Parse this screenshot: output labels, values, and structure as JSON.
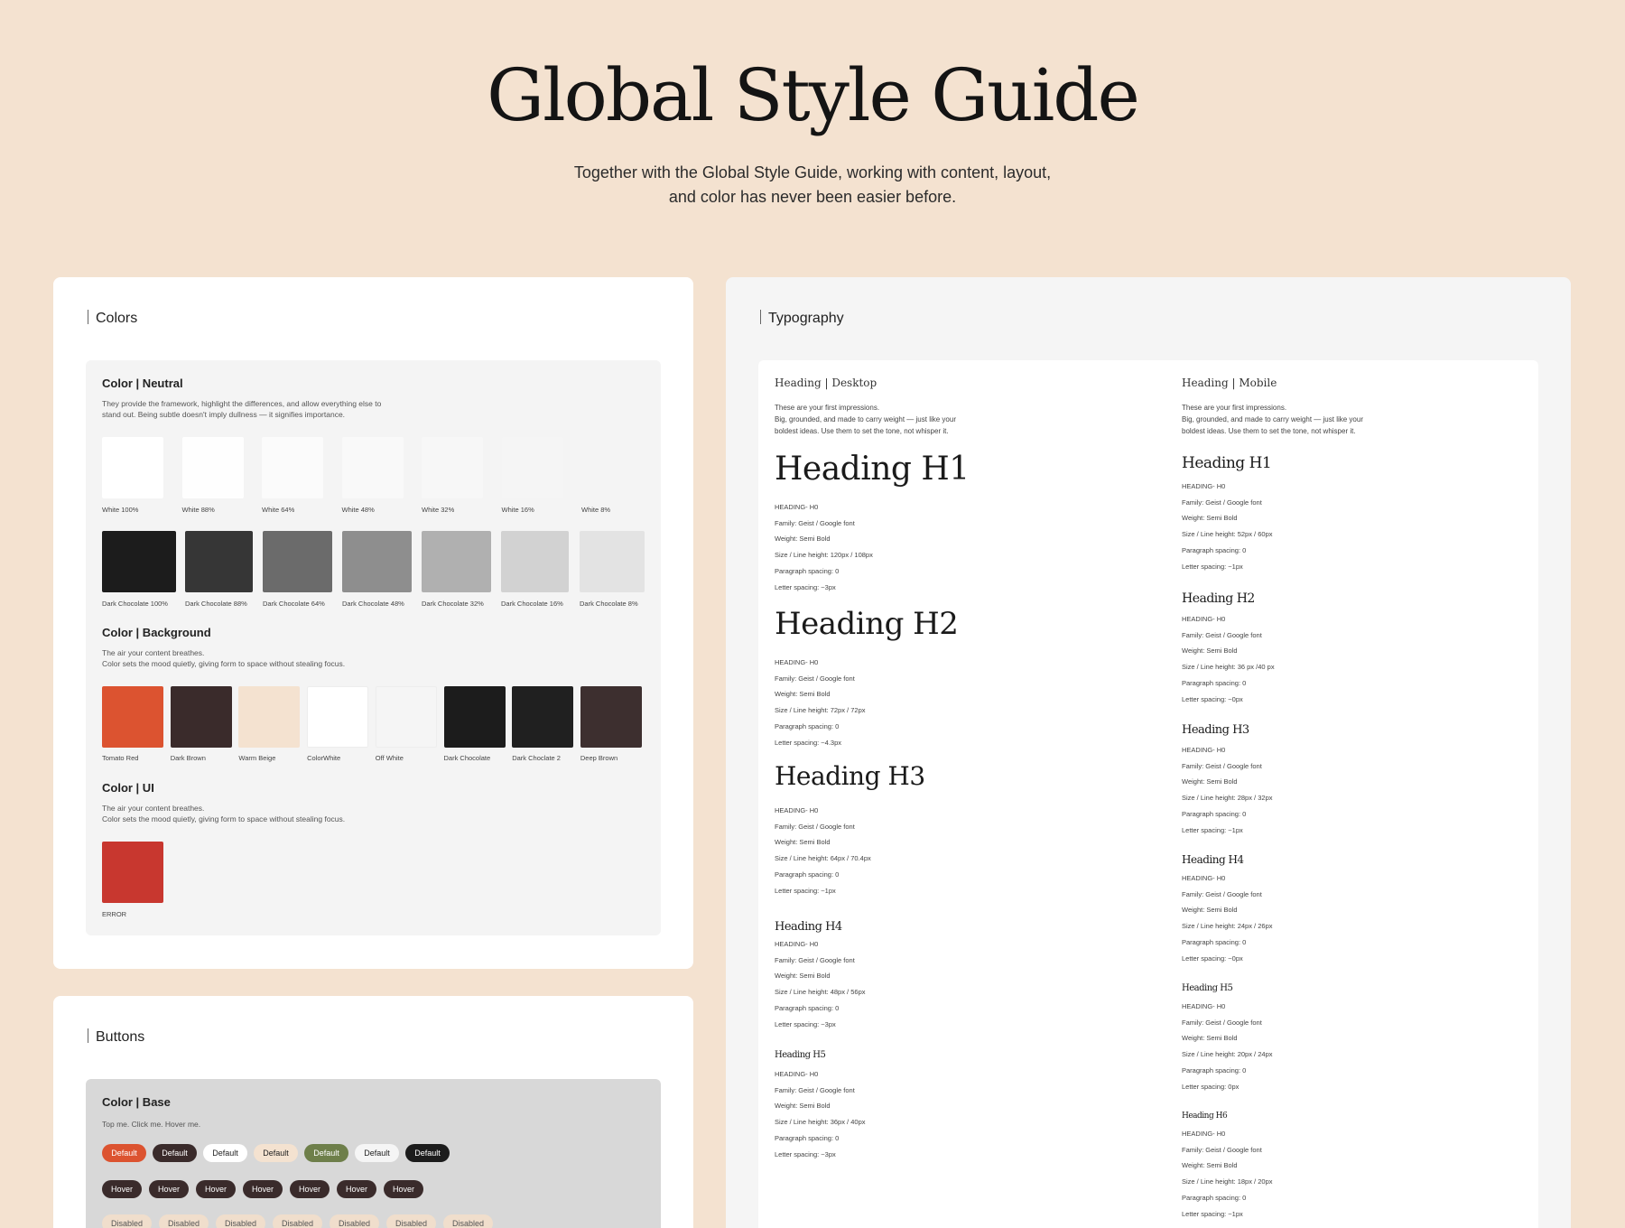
{
  "hero": {
    "title": "Global Style Guide",
    "subtitle_line1": "Together with the Global Style Guide, working with content, layout,",
    "subtitle_line2": "and color has never been easier before."
  },
  "colors": {
    "title": "Colors",
    "neutral": {
      "title": "Color | Neutral",
      "desc1": "They provide the framework, highlight the differences, and allow everything else to",
      "desc2": "stand out. Being subtle doesn't imply dullness — it signifies importance.",
      "whites": [
        {
          "label": "White  100%",
          "color": "#FFFFFF"
        },
        {
          "label": "White  88%",
          "color": "#FEFEFE"
        },
        {
          "label": "White  64%",
          "color": "#FBFBFB"
        },
        {
          "label": "White  48%",
          "color": "#F9F9F9"
        },
        {
          "label": "White  32%",
          "color": "#F7F7F7"
        },
        {
          "label": "White  16%",
          "color": "#F5F5F5"
        },
        {
          "label": "White  8%",
          "color": "#F4F4F4"
        }
      ],
      "darks": [
        {
          "label": "Dark Chocolate  100%",
          "color": "#1C1C1C"
        },
        {
          "label": "Dark Chocolate 88%",
          "color": "#363636"
        },
        {
          "label": "Dark Chocolate  64%",
          "color": "#6B6B6B"
        },
        {
          "label": "Dark Chocolate  48%",
          "color": "#8E8E8E"
        },
        {
          "label": "Dark Chocolate  32%",
          "color": "#B0B0B0"
        },
        {
          "label": "Dark Chocolate  16%",
          "color": "#D2D2D2"
        },
        {
          "label": "Dark Chocolate  8%",
          "color": "#E3E3E3"
        }
      ]
    },
    "background": {
      "title": "Color | Background",
      "desc1": "The air your content breathes.",
      "desc2": "Color sets the mood quietly, giving form to space without stealing focus.",
      "swatches": [
        {
          "label": "Tomato Red",
          "color": "#DC5330"
        },
        {
          "label": "Dark Brown",
          "color": "#3A2B2B"
        },
        {
          "label": "Warm Beige",
          "color": "#F4E2D0"
        },
        {
          "label": "ColorWhite",
          "color": "#FFFFFF"
        },
        {
          "label": "Off White",
          "color": "#F5F5F5"
        },
        {
          "label": "Dark Chocolate",
          "color": "#1C1C1C"
        },
        {
          "label": "Dark Choclate 2",
          "color": "#202020"
        },
        {
          "label": "Deep Brown",
          "color": "#3D2F2F"
        }
      ]
    },
    "ui": {
      "title": "Color | UI",
      "desc1": "The air your content breathes.",
      "desc2": "Color sets the mood quietly, giving form to space without stealing focus.",
      "error": {
        "label": "ERROR",
        "color": "#C8372F"
      }
    }
  },
  "buttons": {
    "title": "Buttons",
    "base": {
      "title": "Color | Base",
      "desc": "Top me. Click me. Hover me."
    },
    "default_row": [
      {
        "label": "Default",
        "bg": "#DC5330",
        "fg": "#FFFFFF"
      },
      {
        "label": "Default",
        "bg": "#3A2B2B",
        "fg": "#FFFFFF"
      },
      {
        "label": "Default",
        "bg": "#FFFFFF",
        "fg": "#222222"
      },
      {
        "label": "Default",
        "bg": "#F4E2D0",
        "fg": "#222222"
      },
      {
        "label": "Default",
        "bg": "#6E7F4A",
        "fg": "#FFFFFF"
      },
      {
        "label": "Default",
        "bg": "#F5F5F5",
        "fg": "#222222"
      },
      {
        "label": "Default",
        "bg": "#1C1C1C",
        "fg": "#FFFFFF"
      }
    ],
    "hover_row": [
      "Hover",
      "Hover",
      "Hover",
      "Hover",
      "Hover",
      "Hover",
      "Hover"
    ],
    "disabled_row": [
      "Disabled",
      "Disabled",
      "Disabled",
      "Disabled",
      "Disabled",
      "Disabled",
      "Disabled"
    ]
  },
  "typography": {
    "title": "Typography",
    "desktop": {
      "title": "Heading | Desktop",
      "desc1": "These are your first impressions.",
      "desc2": "Big, grounded, and made to carry weight — just like your",
      "desc3": "boldest ideas. Use them to set the tone, not whisper it.",
      "headings": [
        {
          "name": "Heading H1",
          "specs": [
            "HEADING- H0",
            "Family: Geist / Google font",
            "Weight: Semi Bold",
            "Size / Line height: 120px / 108px",
            "Paragraph spacing: 0",
            "Letter spacing: ~3px"
          ]
        },
        {
          "name": "Heading H2",
          "specs": [
            "HEADING- H0",
            "Family: Geist / Google font",
            "Weight: Semi Bold",
            "Size / Line height: 72px / 72px",
            "Paragraph spacing: 0",
            "Letter spacing: ~4.3px"
          ]
        },
        {
          "name": "Heading H3",
          "specs": [
            "HEADING- H0",
            "Family: Geist / Google font",
            "Weight: Semi Bold",
            "Size / Line height: 64px / 70.4px",
            "Paragraph spacing: 0",
            "Letter spacing: ~1px"
          ]
        },
        {
          "name": "Heading H4",
          "specs": [
            "HEADING- H0",
            "Family: Geist / Google font",
            "Weight: Semi Bold",
            "Size / Line height: 48px / 56px",
            "Paragraph spacing: 0",
            "Letter spacing: ~3px"
          ]
        },
        {
          "name": "Heading H5",
          "specs": [
            "HEADING- H0",
            "Family: Geist / Google font",
            "Weight: Semi Bold",
            "Size / Line height: 36px / 40px",
            "Paragraph spacing: 0",
            "Letter spacing: ~3px"
          ]
        }
      ]
    },
    "mobile": {
      "title": "Heading | Mobile",
      "desc1": "These are your first impressions.",
      "desc2": "Big, grounded, and made to carry weight — just like your",
      "desc3": "boldest ideas. Use them to set the tone, not whisper it.",
      "headings": [
        {
          "name": "Heading H1",
          "specs": [
            "HEADING- H0",
            "Family: Geist / Google font",
            "Weight: Semi Bold",
            "Size / Line height: 52px / 60px",
            "Paragraph spacing: 0",
            "Letter spacing: ~1px"
          ]
        },
        {
          "name": "Heading H2",
          "specs": [
            "HEADING- H0",
            "Family: Geist / Google font",
            "Weight: Semi Bold",
            "Size / Line height: 36 px /40 px",
            "Paragraph spacing: 0",
            "Letter spacing: ~0px"
          ]
        },
        {
          "name": "Heading H3",
          "specs": [
            "HEADING- H0",
            "Family: Geist / Google font",
            "Weight: Semi Bold",
            "Size / Line height: 28px / 32px",
            "Paragraph spacing: 0",
            "Letter spacing: ~1px"
          ]
        },
        {
          "name": "Heading H4",
          "specs": [
            "HEADING- H0",
            "Family: Geist / Google font",
            "Weight: Semi Bold",
            "Size / Line height: 24px / 26px",
            "Paragraph spacing: 0",
            "Letter spacing: ~0px"
          ]
        },
        {
          "name": "Heading H5",
          "specs": [
            "HEADING- H0",
            "Family: Geist / Google font",
            "Weight: Semi Bold",
            "Size / Line height: 20px / 24px",
            "Paragraph spacing: 0",
            "Letter spacing: 0px"
          ]
        },
        {
          "name": "Heading H6",
          "specs": [
            "HEADING- H0",
            "Family: Geist / Google font",
            "Weight: Semi Bold",
            "Size / Line height: 18px / 20px",
            "Paragraph spacing: 0",
            "Letter spacing: ~1px"
          ]
        }
      ]
    }
  }
}
